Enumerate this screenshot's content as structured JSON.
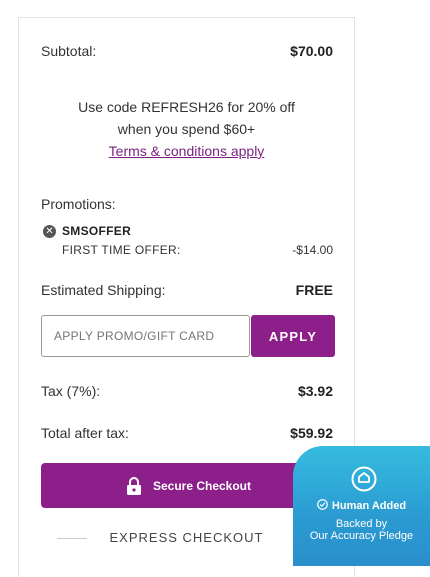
{
  "summary": {
    "subtotal_label": "Subtotal:",
    "subtotal_value": "$70.00",
    "promo_message_line1": "Use code REFRESH26 for 20% off",
    "promo_message_line2": "when you spend $60+",
    "terms_link": "Terms & conditions apply",
    "promotions_label": "Promotions:",
    "promotion": {
      "code": "SMSOFFER",
      "description": "FIRST TIME OFFER:",
      "amount": "-$14.00"
    },
    "shipping_label": "Estimated Shipping:",
    "shipping_value": "FREE",
    "promo_input_placeholder": "APPLY PROMO/GIFT CARD",
    "apply_button": "APPLY",
    "tax_label": "Tax (7%):",
    "tax_value": "$3.92",
    "total_label": "Total after tax:",
    "total_value": "$59.92",
    "checkout_button": "Secure Checkout",
    "express_checkout": "EXPRESS CHECKOUT"
  },
  "badge": {
    "title": "Human Added",
    "subtitle_line1": "Backed by",
    "subtitle_line2": "Our Accuracy Pledge"
  },
  "colors": {
    "brand_purple": "#8d1f8a",
    "badge_blue": "#2b9ad1"
  },
  "icons": [
    "remove-promo-icon",
    "lock-icon",
    "badge-logo-icon",
    "check-circle-icon"
  ]
}
